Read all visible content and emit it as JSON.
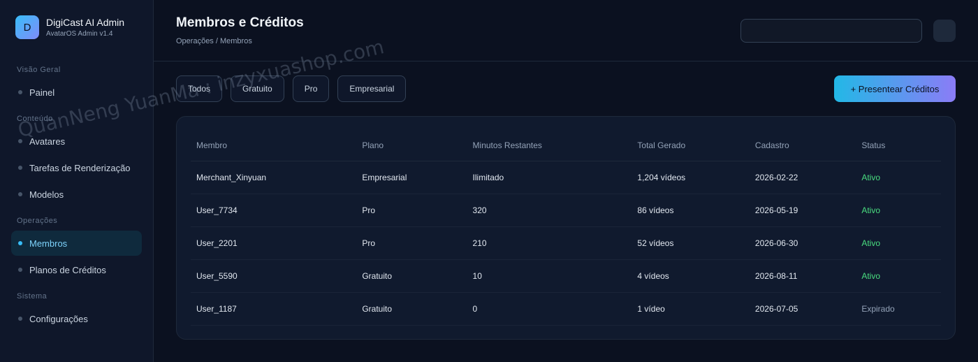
{
  "brand": {
    "logo_letter": "D",
    "title": "DigiCast AI Admin",
    "subtitle": "AvatarOS Admin v1.4"
  },
  "sidebar": {
    "sections": [
      {
        "label": "Visão Geral",
        "items": [
          "Painel"
        ]
      },
      {
        "label": "Conteúdo",
        "items": [
          "Avatares",
          "Tarefas de Renderização",
          "Modelos"
        ]
      },
      {
        "label": "Operações",
        "items": [
          "Membros",
          "Planos de Créditos"
        ]
      },
      {
        "label": "Sistema",
        "items": [
          "Configurações"
        ]
      }
    ],
    "active_item": "Membros"
  },
  "header": {
    "title": "Membros e Créditos",
    "breadcrumb": "Operações / Membros",
    "search_value": ""
  },
  "filters": [
    "Todos",
    "Gratuito",
    "Pro",
    "Empresarial"
  ],
  "gift_button": "+ Presentear Créditos",
  "table": {
    "columns": [
      "Membro",
      "Plano",
      "Minutos Restantes",
      "Total Gerado",
      "Cadastro",
      "Status"
    ],
    "rows": [
      [
        "Merchant_Xinyuan",
        "Empresarial",
        "Ilimitado",
        "1,204 vídeos",
        "2026-02-22",
        "Ativo"
      ],
      [
        "User_7734",
        "Pro",
        "320",
        "86 vídeos",
        "2026-05-19",
        "Ativo"
      ],
      [
        "User_2201",
        "Pro",
        "210",
        "52 vídeos",
        "2026-06-30",
        "Ativo"
      ],
      [
        "User_5590",
        "Gratuito",
        "10",
        "4 vídeos",
        "2026-08-11",
        "Ativo"
      ],
      [
        "User_1187",
        "Gratuito",
        "0",
        "1 vídeo",
        "2026-07-05",
        "Expirado"
      ]
    ]
  },
  "watermark": "QuanNeng YuanMa : inzyxuashop.com",
  "colors": {
    "accent": "#38bdf8",
    "active_status": "#4ade80",
    "expired_status": "#94a3b8",
    "background": "#0b1120"
  }
}
